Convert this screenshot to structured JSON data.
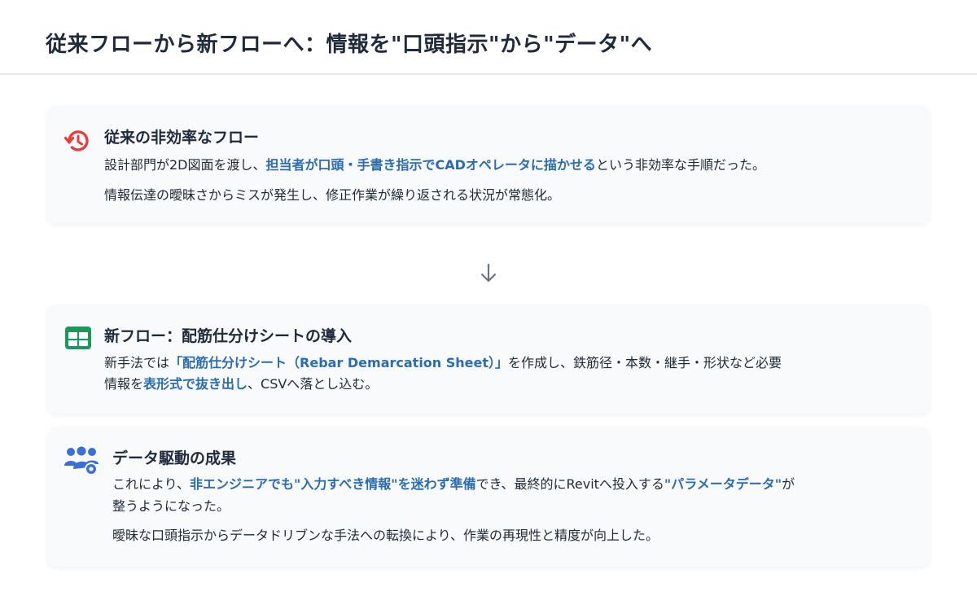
{
  "header": {
    "title": "従来フローから新フローへ：情報を\"口頭指示\"から\"データ\"へ"
  },
  "cards": [
    {
      "icon": "history-icon",
      "title": "従来の非効率なフロー",
      "lines": [
        {
          "segments": [
            {
              "text": "設計部門が2D図面を渡し、",
              "highlight": false
            },
            {
              "text": "担当者が口頭・手書き指示でCADオペレータに描かせる",
              "highlight": true
            },
            {
              "text": "という非効率な手順だった。",
              "highlight": false
            }
          ]
        },
        {
          "segments": [
            {
              "text": "情報伝達の曖昧さからミスが発生し、修正作業が繰り返される状況が常態化。",
              "highlight": false
            }
          ]
        }
      ]
    },
    {
      "icon": "table-icon",
      "title": "新フロー：配筋仕分けシートの導入",
      "lines": [
        {
          "segments": [
            {
              "text": "新手法では",
              "highlight": false
            },
            {
              "text": "「配筋仕分けシート（Rebar Demarcation Sheet）」",
              "highlight": true
            },
            {
              "text": "を作成し、鉄筋径・本数・継手・形状など必要",
              "highlight": false
            }
          ]
        },
        {
          "segments": [
            {
              "text": "情報を",
              "highlight": false
            },
            {
              "text": "表形式で抜き出し",
              "highlight": true
            },
            {
              "text": "、CSVへ落とし込む。",
              "highlight": false
            }
          ]
        }
      ]
    },
    {
      "icon": "users-gear-icon",
      "title": "データ駆動の成果",
      "lines": [
        {
          "segments": [
            {
              "text": "これにより、",
              "highlight": false
            },
            {
              "text": "非エンジニアでも\"入力すべき情報\"を迷わず準備",
              "highlight": true
            },
            {
              "text": "でき、最終的にRevitへ投入する",
              "highlight": false
            },
            {
              "text": "\"パラメータデータ\"",
              "highlight": true
            },
            {
              "text": "が",
              "highlight": false
            }
          ]
        },
        {
          "segments": [
            {
              "text": "整うようになった。",
              "highlight": false
            }
          ]
        },
        {
          "segments": [
            {
              "text": "曖昧な口頭指示からデータドリブンな手法への転換により、作業の再現性と精度が向上した。",
              "highlight": false
            }
          ]
        }
      ]
    }
  ],
  "colors": {
    "accent": "#2b6cb0",
    "history_icon": "#e53e3e",
    "table_icon": "#1a9a5a",
    "users_icon": "#3b6fd8",
    "arrow": "#6b7280"
  },
  "arrow_icon": "arrow-down-icon"
}
